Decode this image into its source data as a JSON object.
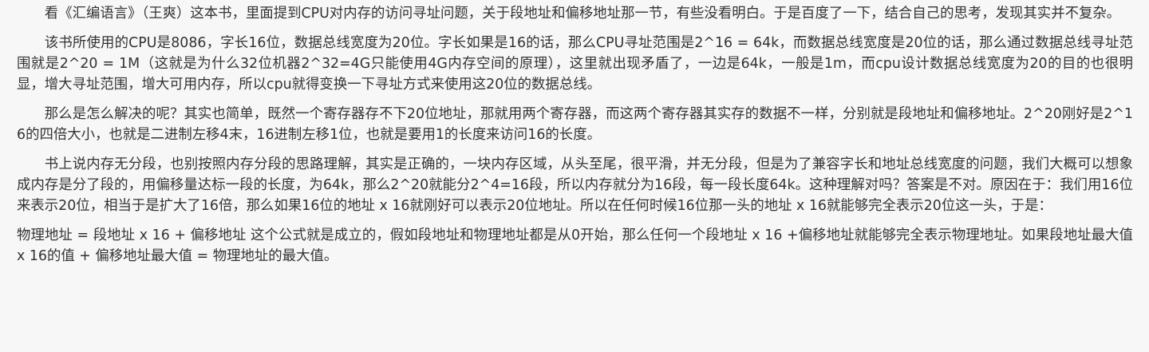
{
  "article": {
    "paragraphs": [
      {
        "text": "看《汇编语言》（王爽）这本书，里面提到CPU对内存的访问寻址问题，关于段地址和偏移地址那一节，有些没看明白。于是百度了一下，结合自己的思考，发现其实并不复杂。",
        "indent": true
      },
      {
        "text": "该书所使用的CPU是8086，字长16位，数据总线宽度为20位。字长如果是16的话，那么CPU寻址范围是2^16 = 64k，而数据总线宽度是20位的话，那么通过数据总线寻址范围就是2^20 = 1M（这就是为什么32位机器2^32=4G只能使用4G内存空间的原理），这里就出现矛盾了，一边是64k，一般是1m，而cpu设计数据总线宽度为20的目的也很明显，增大寻址范围，增大可用内存，所以cpu就得变换一下寻址方式来使用这20位的数据总线。",
        "indent": true
      },
      {
        "text": "那么是怎么解决的呢？其实也简单，既然一个寄存器存不下20位地址，那就用两个寄存器，而这两个寄存器其实存的数据不一样，分别就是段地址和偏移地址。2^20刚好是2^16的四倍大小，也就是二进制左移4末，16进制左移1位，也就是要用1的长度来访问16的长度。",
        "indent": true
      },
      {
        "text": "书上说内存无分段，也别按照内存分段的思路理解，其实是正确的，一块内存区域，从头至尾，很平滑，并无分段，但是为了兼容字长和地址总线宽度的问题，我们大概可以想象成内存是分了段的，用偏移量达标一段的长度，为64k，那么2^20就能分2^4=16段，所以内存就分为16段，每一段长度64k。这种理解对吗？答案是不对。原因在于：我们用16位来表示20位，相当于是扩大了16倍，那么如果16位的地址 x 16就刚好可以表示20位地址。所以在任何时候16位那一头的地址 x 16就能够完全表示20位这一头，于是：",
        "indent": true
      },
      {
        "text": "物理地址 = 段地址 x 16 + 偏移地址 这个公式就是成立的，假如段地址和物理地址都是从0开始，那么任何一个段地址 x 16 +偏移地址就能够完全表示物理地址。如果段地址最大值 x 16的值 + 偏移地址最大值 = 物理地址的最大值。",
        "indent": false
      }
    ]
  }
}
